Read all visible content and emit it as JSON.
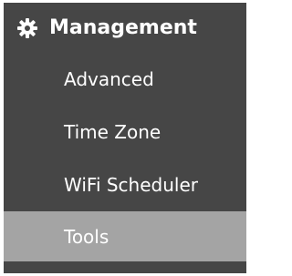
{
  "menu": {
    "header": {
      "label": "Management",
      "icon": "gear-icon"
    },
    "items": [
      {
        "label": "Advanced",
        "active": false
      },
      {
        "label": "Time Zone",
        "active": false
      },
      {
        "label": "WiFi Scheduler",
        "active": false
      },
      {
        "label": "Tools",
        "active": true
      }
    ],
    "colors": {
      "background": "#464646",
      "active_background": "#a4a4a4",
      "text": "#ffffff"
    }
  }
}
